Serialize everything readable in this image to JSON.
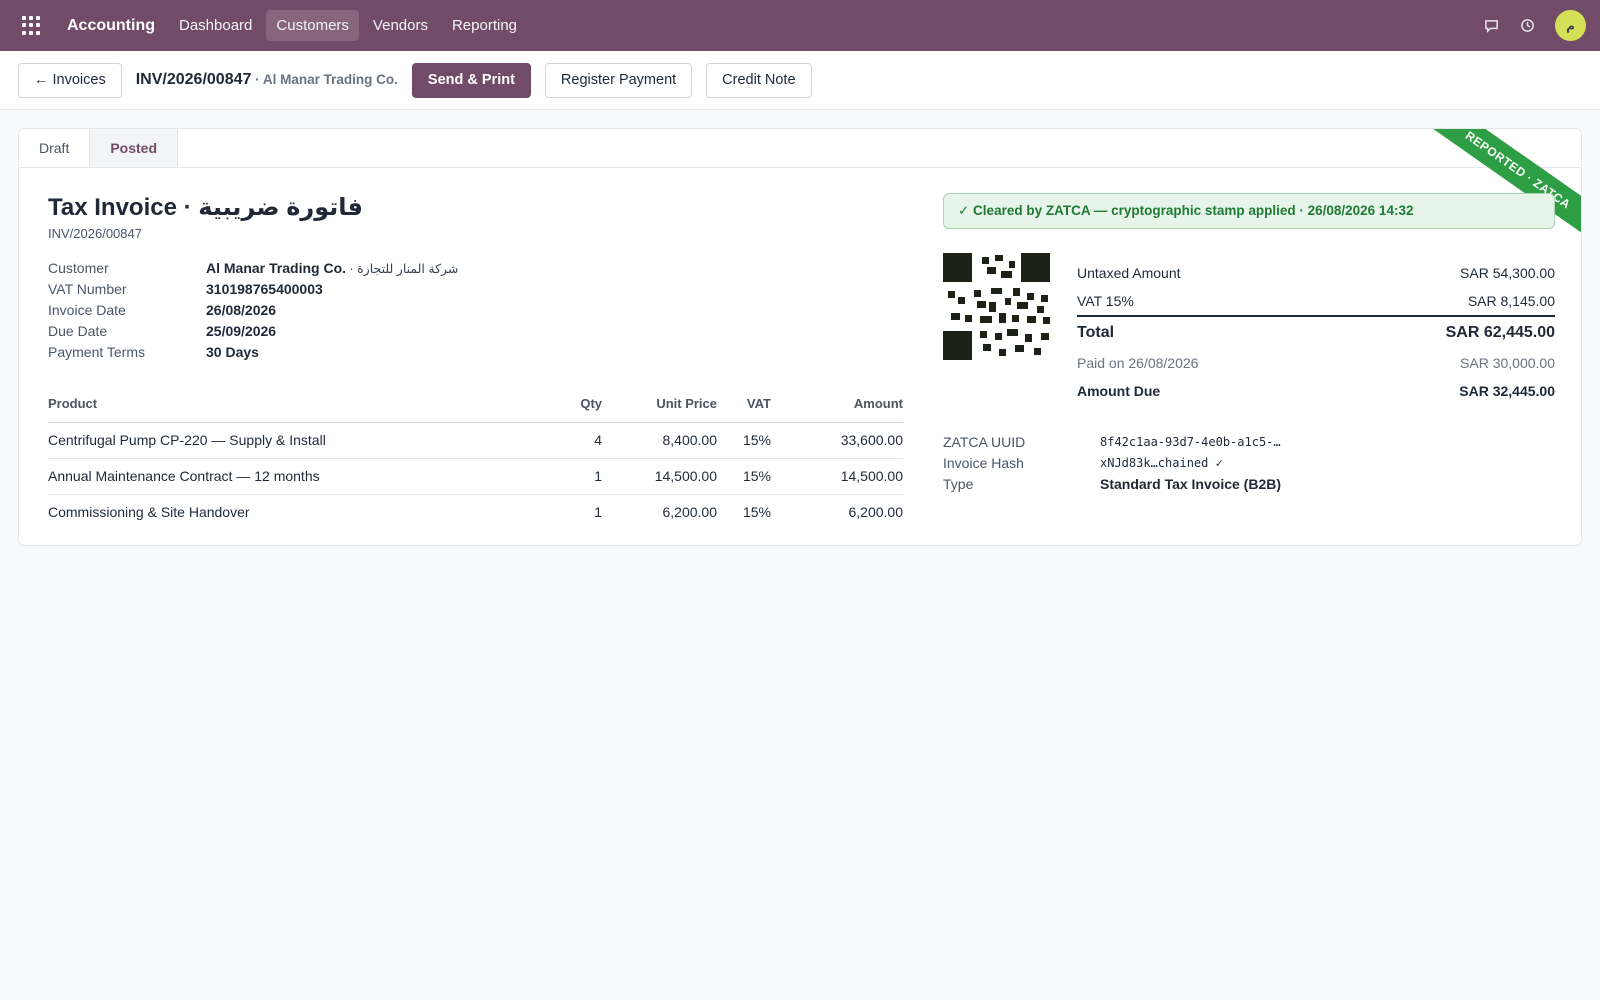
{
  "topbar": {
    "app_name": "Accounting",
    "menu": [
      "Dashboard",
      "Customers",
      "Vendors",
      "Reporting"
    ],
    "active_menu": "Customers",
    "avatar_initial": "م"
  },
  "control": {
    "back_label": "← Invoices",
    "record_name": "INV/2026/00847",
    "record_partner": " · Al Manar Trading Co.",
    "send_print": "Send & Print",
    "register_payment": "Register Payment",
    "credit_note": "Credit Note"
  },
  "status": {
    "draft": "Draft",
    "posted": "Posted",
    "active": "Posted"
  },
  "ribbon": "REPORTED · ZATCA",
  "invoice": {
    "title": "Tax Invoice · فاتورة ضريبية",
    "number": "INV/2026/00847",
    "fields": {
      "customer_label": "Customer",
      "customer_value": "Al Manar Trading Co.",
      "customer_ar": " · شركة المنار للتجارة",
      "vat_label": "VAT Number",
      "vat_value": "310198765400003",
      "invoice_date_label": "Invoice Date",
      "invoice_date_value": "26/08/2026",
      "due_date_label": "Due Date",
      "due_date_value": "25/09/2026",
      "terms_label": "Payment Terms",
      "terms_value": "30 Days"
    },
    "columns": {
      "product": "Product",
      "qty": "Qty",
      "unit_price": "Unit Price",
      "vat": "VAT",
      "amount": "Amount"
    },
    "lines": [
      {
        "product": "Centrifugal Pump CP-220 — Supply & Install",
        "qty": "4",
        "unit_price": "8,400.00",
        "vat": "15%",
        "amount": "33,600.00"
      },
      {
        "product": "Annual Maintenance Contract — 12 months",
        "qty": "1",
        "unit_price": "14,500.00",
        "vat": "15%",
        "amount": "14,500.00"
      },
      {
        "product": "Commissioning & Site Handover",
        "qty": "1",
        "unit_price": "6,200.00",
        "vat": "15%",
        "amount": "6,200.00"
      }
    ]
  },
  "zatca_banner": "✓ Cleared by ZATCA — cryptographic stamp applied · 26/08/2026 14:32",
  "totals": {
    "untaxed_label": "Untaxed Amount",
    "untaxed_value": "SAR 54,300.00",
    "vat_label": "VAT 15%",
    "vat_value": "SAR 8,145.00",
    "total_label": "Total",
    "total_value": "SAR 62,445.00",
    "paid_label": "Paid on 26/08/2026",
    "paid_value": "SAR 30,000.00",
    "due_label": "Amount Due",
    "due_value": "SAR 32,445.00"
  },
  "zatca": {
    "uuid_label": "ZATCA UUID",
    "uuid_value": "8f42c1aa-93d7-4e0b-a1c5-…",
    "hash_label": "Invoice Hash",
    "hash_value": "xNJd83k…chained ✓",
    "type_label": "Type",
    "type_value": "Standard Tax Invoice (B2B)"
  },
  "icons": {
    "apps": "apps-grid-icon",
    "chat": "chat-icon",
    "activity": "clock-icon",
    "qr": "qr-code"
  },
  "colors": {
    "brand": "#714b67",
    "ribbon": "#2e9e44",
    "success_text": "#1f7a33"
  }
}
